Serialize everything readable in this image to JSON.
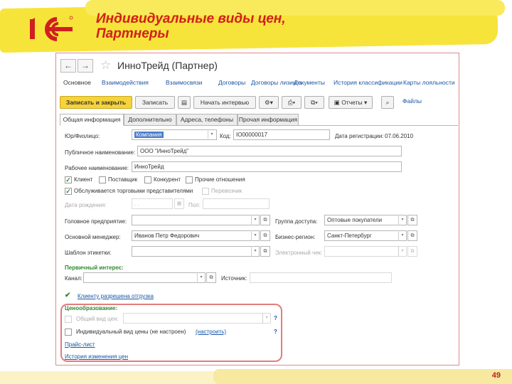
{
  "slide": {
    "title_line1": "Индивидуальные виды цен,",
    "title_line2": "Партнеры",
    "page_number": "49",
    "logo_alt": "1С"
  },
  "window": {
    "title": "ИнноТрейд (Партнер)",
    "nav_back": "←",
    "nav_forward": "→",
    "star_icon": "star-icon"
  },
  "links": [
    "Основное",
    "Взаимодействия",
    "Взаимосвязи",
    "Договоры",
    "Договоры лизинга",
    "Документы",
    "История классификации",
    "Карты лояльности"
  ],
  "toolbar": {
    "save_close": "Записать и закрыть",
    "save": "Записать",
    "start_interaction": "Начать интервью",
    "reports": "Отчеты",
    "files": "Файлы"
  },
  "tabs": [
    "Общая информация",
    "Дополнительно",
    "Адреса, телефоны",
    "Прочая информация"
  ],
  "form": {
    "legal_label": "Юр/Физлицо:",
    "legal_value": "Компания",
    "code_label": "Код:",
    "code_value": "IO00000017",
    "reg_date_label": "Дата регистрации:",
    "reg_date_value": "07.06.2010",
    "public_name_label": "Публичное наименование:",
    "public_name_value": "ООО \"ИнноТрейд\"",
    "work_name_label": "Рабочее наименование:",
    "work_name_value": "ИнноТрейд",
    "cb_client": "Клиент",
    "cb_supplier": "Поставщик",
    "cb_competitor": "Конкурент",
    "cb_other": "Прочие отношения",
    "cb_served": "Обслуживается торговыми представителями",
    "cb_reseller": "Перевозчик",
    "birth_label": "Дата рождения:",
    "birth_value": ". .",
    "gender_label": "Пол:",
    "head_label": "Головное предприятие:",
    "access_group_label": "Группа доступа:",
    "access_group_value": "Оптовые покупатели",
    "manager_label": "Основной менеджер:",
    "manager_value": "Иванов Петр Федорович",
    "region_label": "Бизнес-регион:",
    "region_value": "Санкт-Петербург",
    "label_template_label": "Шаблон этикетки:",
    "e_check_label": "Электронный чек:",
    "interest_title": "Первичный интерес:",
    "channel_label": "Канал:",
    "source_label": "Источник:",
    "shipment_allowed": "Клиенту разрешена отгрузка",
    "pricing_title": "Ценообразование:",
    "common_price_label": "Общий вид цен:",
    "individual_price_label": "Индивидуальный вид цены (не настроен)",
    "configure_link": "(настроить)",
    "price_list_link": "Прайс-лист",
    "price_history_link": "История изменения цен",
    "help_mark": "?"
  }
}
